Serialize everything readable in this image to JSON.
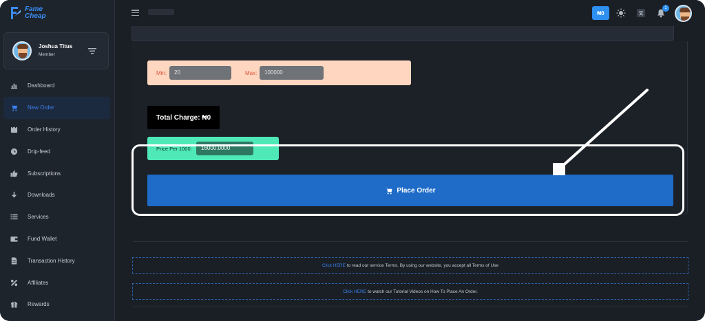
{
  "brand": {
    "name_line1": "Fame",
    "name_line2": "Cheap"
  },
  "user": {
    "name": "Joshua Titus",
    "role": "Member"
  },
  "nav": {
    "items": [
      {
        "label": "Dashboard",
        "icon": "chart-bar-icon",
        "active": false
      },
      {
        "label": "New Order",
        "icon": "cart-icon",
        "active": true
      },
      {
        "label": "Order History",
        "icon": "calendar-icon",
        "active": false
      },
      {
        "label": "Drip-feed",
        "icon": "clock-icon",
        "active": false
      },
      {
        "label": "Subscriptions",
        "icon": "thumbs-up-icon",
        "active": false
      },
      {
        "label": "Downloads",
        "icon": "arrow-down-icon",
        "active": false
      },
      {
        "label": "Services",
        "icon": "list-icon",
        "active": false
      },
      {
        "label": "Fund Wallet",
        "icon": "wallet-icon",
        "active": false
      },
      {
        "label": "Transaction History",
        "icon": "file-icon",
        "active": false
      },
      {
        "label": "Affiliates",
        "icon": "percent-icon",
        "active": false
      },
      {
        "label": "Rewards",
        "icon": "gift-icon",
        "active": false
      }
    ]
  },
  "topbar": {
    "balance": "₦0",
    "notification_count": "1"
  },
  "order_form": {
    "min_label": "Min:",
    "min_value": "20",
    "max_label": "Max:",
    "max_value": "100000",
    "total_charge": "Total Charge: ₦0",
    "price_label": "Price Per 1000:",
    "price_value": "16000.0000",
    "place_order_label": "Place Order"
  },
  "notices": {
    "terms_link": "Click HERE",
    "terms_text": "to read our service Terms. By using our website, you accept all Terms of Use",
    "tutorial_link": "Click HERE",
    "tutorial_text": "to watch our Tutorial Videos on How To Place An Order."
  },
  "colors": {
    "background": "#1a1f26",
    "accent": "#1e6bc8",
    "minmax_bg": "#ffd6bf",
    "price_bg": "#4ee9b7",
    "active_nav": "#3b7ff0"
  }
}
